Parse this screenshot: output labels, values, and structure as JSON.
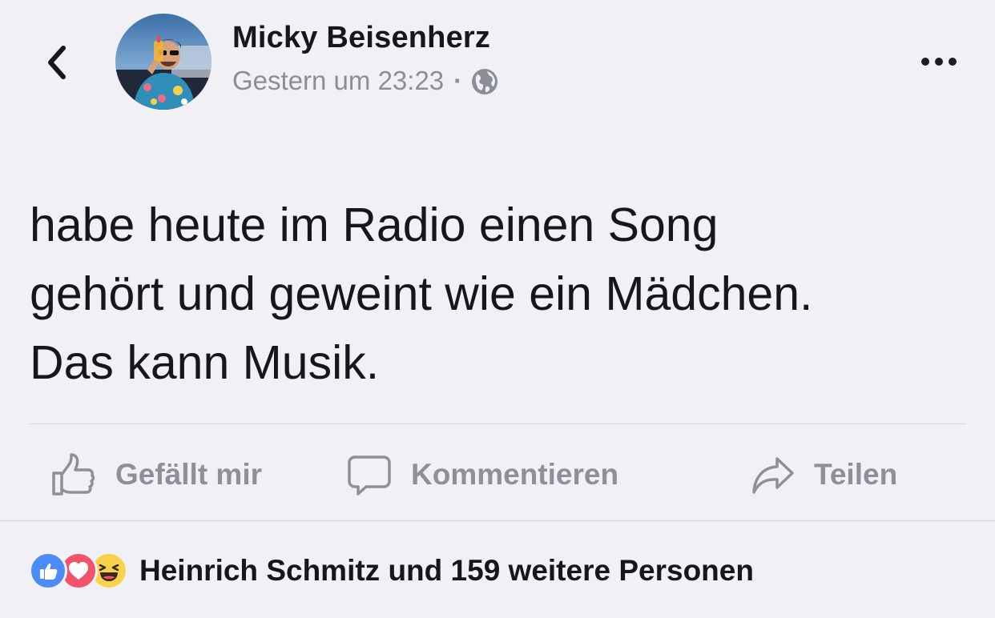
{
  "header": {
    "author_name": "Micky Beisenherz",
    "timestamp": "Gestern um 23:23",
    "separator": "·",
    "privacy_icon": "globe-icon",
    "back_icon": "chevron-left-icon",
    "more_icon": "more-horizontal-icon"
  },
  "post": {
    "text": "habe heute im Radio einen Song\ngehört und geweint wie ein Mädchen.\nDas kann Musik."
  },
  "actions": {
    "like_label": "Gefällt mir",
    "comment_label": "Kommentieren",
    "share_label": "Teilen"
  },
  "reactions": {
    "icons": [
      "like-reaction-icon",
      "love-reaction-icon",
      "haha-reaction-icon"
    ],
    "summary": "Heinrich Schmitz und 159 weitere Personen"
  },
  "colors": {
    "background": "#f1f1f5",
    "text_primary": "#15171c",
    "text_secondary": "#8b8e96",
    "like_blue": "#4b8df8",
    "love_red": "#f0536a",
    "haha_yellow": "#f9d24c"
  }
}
